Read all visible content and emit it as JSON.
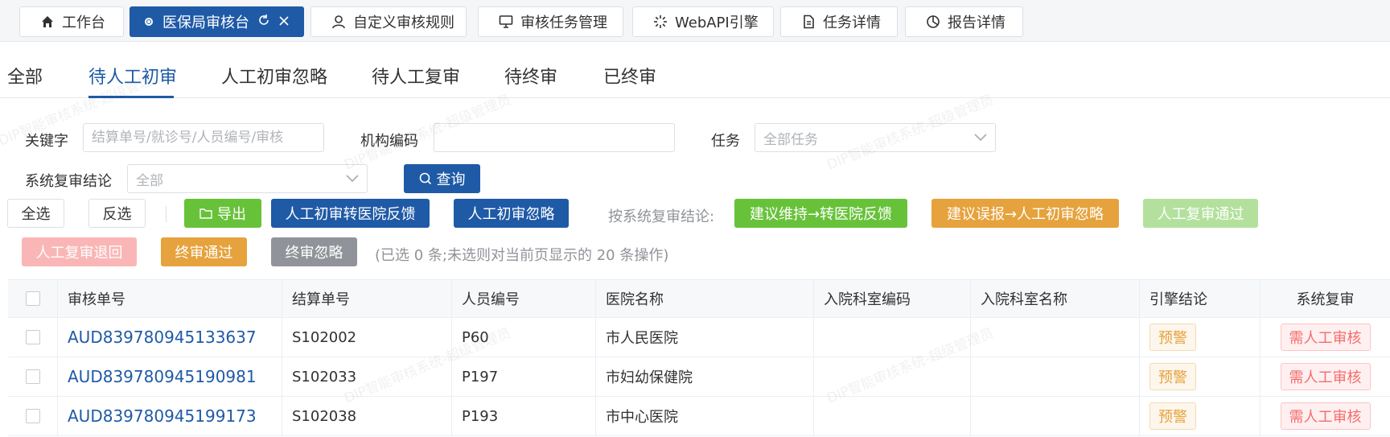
{
  "top_tabs": [
    {
      "label": "工作台",
      "icon": "home-icon"
    },
    {
      "label": "医保局审核台",
      "icon": "radio-dot-icon",
      "active": true
    },
    {
      "label": "自定义审核规则",
      "icon": "user-icon"
    },
    {
      "label": "审核任务管理",
      "icon": "monitor-icon"
    },
    {
      "label": "WebAPI引擎",
      "icon": "loading-icon"
    },
    {
      "label": "任务详情",
      "icon": "document-icon"
    },
    {
      "label": "报告详情",
      "icon": "pie-chart-icon"
    }
  ],
  "status_tabs": [
    "全部",
    "待人工初审",
    "人工初审忽略",
    "待人工复审",
    "待终审",
    "已终审"
  ],
  "filters": {
    "keyword_label": "关键字",
    "keyword_placeholder": "结算单号/就诊号/人员编号/审核",
    "org_code_label": "机构编码",
    "org_code_value": "",
    "task_label": "任务",
    "task_placeholder": "全部任务",
    "sys_conclusion_label": "系统复审结论",
    "sys_conclusion_placeholder": "全部",
    "query_label": "查询"
  },
  "actions": {
    "select_all": "全选",
    "invert": "反选",
    "export": "导出",
    "to_hospital_feedback": "人工初审转医院反馈",
    "ignore": "人工初审忽略",
    "by_system_label": "按系统复审结论:",
    "suggest_keep": "建议维持→转医院反馈",
    "suggest_false": "建议误报→人工初审忽略",
    "review_pass": "人工复审通过",
    "review_return": "人工复审退回",
    "final_pass": "终审通过",
    "final_ignore": "终审忽略",
    "selection_hint": "(已选 0 条;未选则对当前页显示的 20 条操作)"
  },
  "table": {
    "columns": [
      "审核单号",
      "结算单号",
      "人员编号",
      "医院名称",
      "入院科室编码",
      "入院科室名称",
      "引擎结论",
      "系统复审"
    ],
    "rows": [
      {
        "audit_no": "AUD839780945133637",
        "settle_no": "S102002",
        "person_no": "P60",
        "hospital": "市人民医院",
        "dept_code": "",
        "dept_name": "",
        "engine": "预警",
        "system": "需人工审核"
      },
      {
        "audit_no": "AUD839780945190981",
        "settle_no": "S102033",
        "person_no": "P197",
        "hospital": "市妇幼保健院",
        "dept_code": "",
        "dept_name": "",
        "engine": "预警",
        "system": "需人工审核"
      },
      {
        "audit_no": "AUD839780945199173",
        "settle_no": "S102038",
        "person_no": "P193",
        "hospital": "市中心医院",
        "dept_code": "",
        "dept_name": "",
        "engine": "预警",
        "system": "需人工审核"
      }
    ]
  },
  "watermark": "DIP智能审核系统-超级管理员",
  "colors": {
    "primary": "#1f5aa6",
    "green": "#67c23a",
    "orange": "#e6a23c",
    "gray": "#909399",
    "red_light": "#fab6b6"
  }
}
